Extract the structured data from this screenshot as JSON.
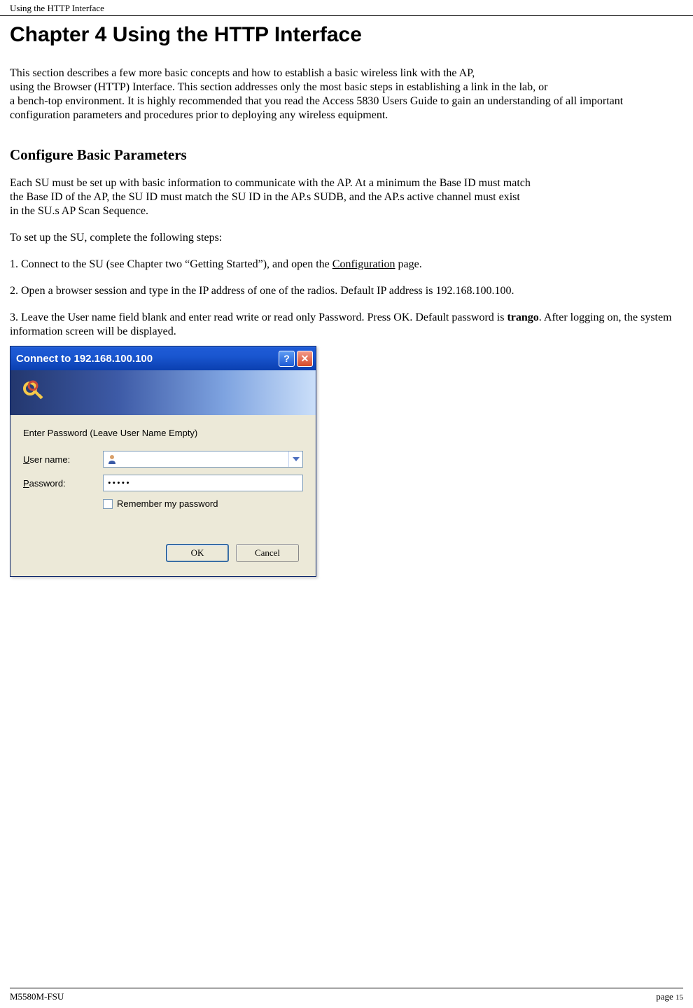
{
  "header": {
    "running_head": "Using the HTTP Interface"
  },
  "chapter": {
    "title": "Chapter 4 Using the HTTP Interface"
  },
  "intro": {
    "p1": "This section describes a few more basic concepts and how to establish a basic wireless link with the AP,",
    "p2": "using the Browser (HTTP) Interface. This section addresses only the most basic steps in establishing a link in the lab, or",
    "p3": "a bench-top environment.  It is highly recommended that you read the Access 5830 Users Guide to gain an understanding of all important configuration parameters and procedures prior to deploying any wireless equipment."
  },
  "section": {
    "title": "Configure Basic Parameters",
    "p1": "Each SU must be set up with basic information to communicate with the AP.  At a minimum the Base ID must match",
    "p2": "the Base ID of the AP, the SU ID must match the SU ID in the AP.s SUDB, and the AP.s active channel must exist",
    "p3": "in the SU.s AP Scan Sequence.",
    "p4": "To set up the SU, complete the following steps:",
    "step1_pre": "1.  Connect to the SU (see Chapter two “Getting Started”), and open the ",
    "step1_link": "Configuration",
    "step1_post": " page.",
    "step2": "2. Open a browser session and type in the IP address of one of the radios. Default IP address is 192.168.100.100.",
    "step3_pre": "3. Leave the User name field blank and enter read write or read only Password. Press OK. Default password is ",
    "step3_bold": "trango",
    "step3_post": ".  After logging on, the system information screen will be displayed."
  },
  "dialog": {
    "title": "Connect to 192.168.100.100",
    "help_btn": "?",
    "close_btn": "✕",
    "prompt": "Enter Password (Leave User Name Empty)",
    "username_label_u": "U",
    "username_label_rest": "ser name:",
    "username_value": "",
    "password_label_p": "P",
    "password_label_rest": "assword:",
    "password_value": "•••••",
    "remember_r": "R",
    "remember_rest": "emember my password",
    "ok": "OK",
    "cancel": "Cancel"
  },
  "footer": {
    "left": "M5580M-FSU",
    "right_label": "page ",
    "right_num": "15"
  }
}
